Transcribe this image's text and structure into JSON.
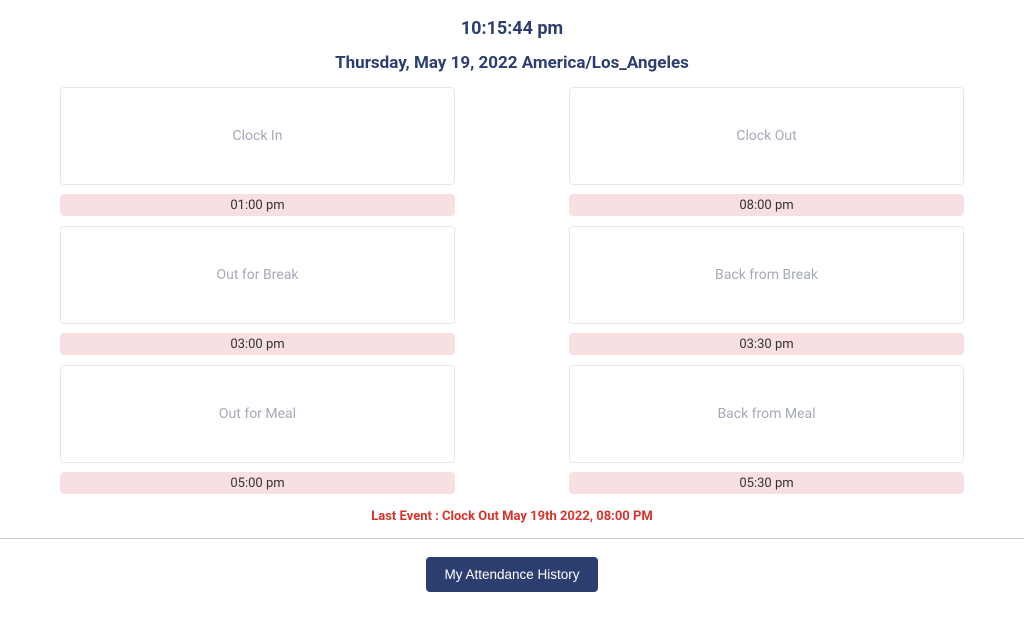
{
  "header": {
    "time": "10:15:44 pm",
    "date": "Thursday, May 19, 2022 America/Los_Angeles"
  },
  "cards": {
    "clock_in": {
      "label": "Clock In",
      "time": "01:00 pm"
    },
    "clock_out": {
      "label": "Clock Out",
      "time": "08:00 pm"
    },
    "out_break": {
      "label": "Out for Break",
      "time": "03:00 pm"
    },
    "back_break": {
      "label": "Back from Break",
      "time": "03:30 pm"
    },
    "out_meal": {
      "label": "Out for Meal",
      "time": "05:00 pm"
    },
    "back_meal": {
      "label": "Back from Meal",
      "time": "05:30 pm"
    }
  },
  "last_event": "Last Event : Clock Out May 19th 2022, 08:00 PM",
  "footer": {
    "history_button": "My Attendance History"
  }
}
